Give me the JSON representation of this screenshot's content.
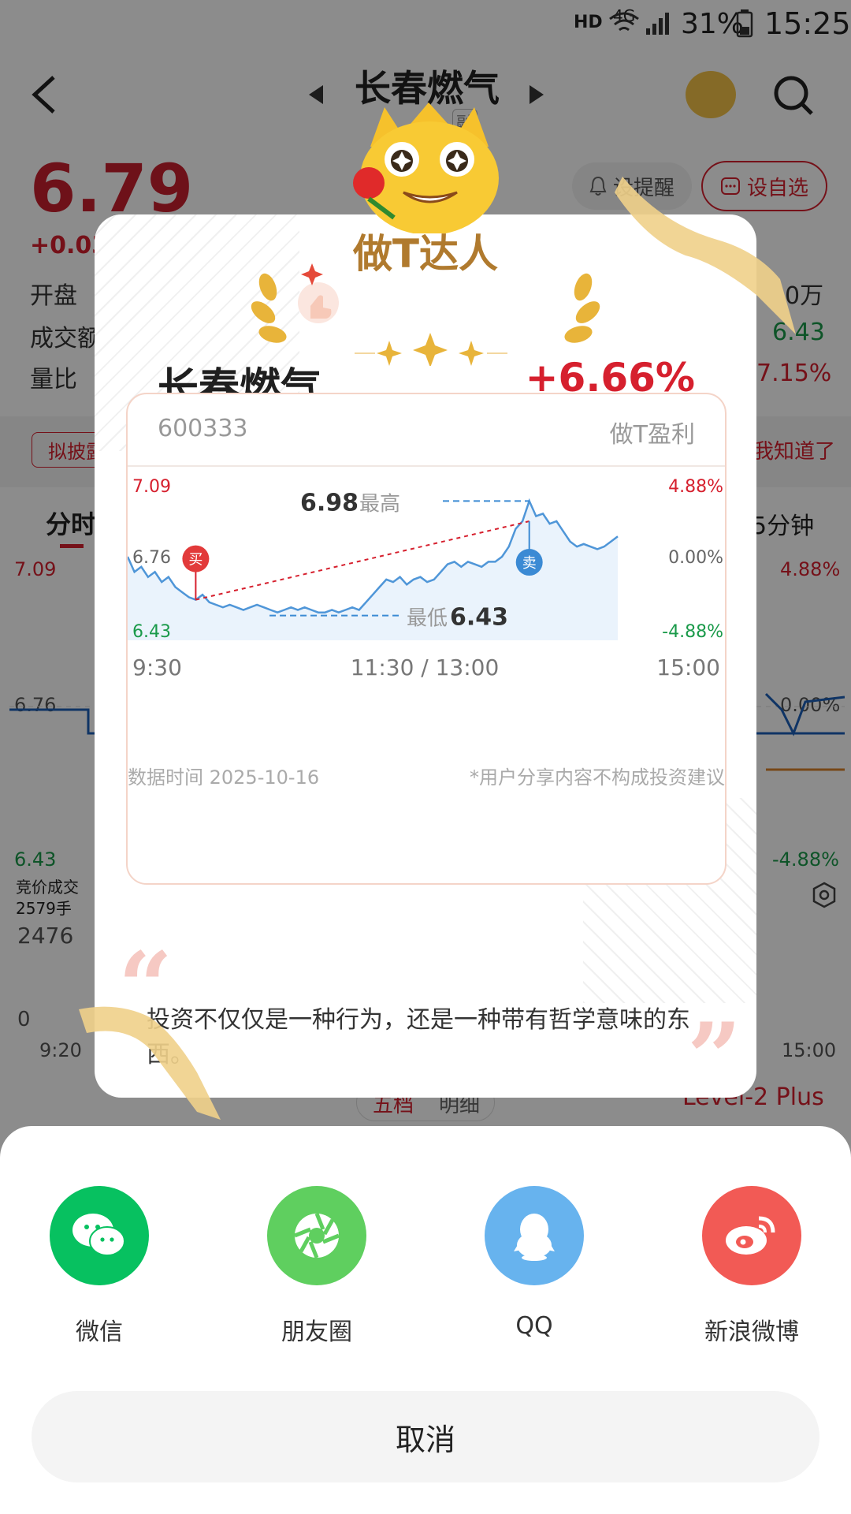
{
  "status_bar": {
    "hd": "HD",
    "network": "4G",
    "battery": "31%",
    "time": "15:25"
  },
  "header": {
    "title": "长春燃气",
    "subtitle": "融"
  },
  "background": {
    "price": "6.79",
    "change": "+0.03",
    "alert_button": "设提醒",
    "watchlist_button": "设自选",
    "labels": {
      "open": "开盘",
      "turnover": "成交额",
      "volume_ratio": "量比"
    },
    "right_values": {
      "volume": "0万",
      "high": "6.43",
      "ratio": "7.15%"
    },
    "notice_left": "拟披露",
    "notice_right": "我知道了",
    "tab_timeshare": "分时",
    "tab_5min": "5分钟",
    "left_axis": {
      "top": "7.09",
      "mid": "6.76",
      "bottom": "6.43"
    },
    "right_axis": {
      "top": "4.88%",
      "mid": "0.00%",
      "bottom": "-4.88%"
    },
    "auction_label": "竞价成交",
    "auction_volume": "2579手",
    "volume_value": "2476",
    "volume_zero": "0",
    "time_start": "9:20",
    "time_end": "15:00",
    "tab_five_levels": "五档",
    "tab_detail": "明细",
    "level2": "Level-2 Plus"
  },
  "card": {
    "badge_title": "做T达人",
    "stock_name": "长春燃气",
    "stock_change": "+6.66%",
    "code": "600333",
    "profit_label": "做T盈利",
    "high_value": "6.98",
    "high_label": "最高",
    "low_label": "最低",
    "low_value": "6.43",
    "buy_marker": "买",
    "sell_marker": "卖",
    "data_time": "数据时间 2025-10-16",
    "disclaimer": "*用户分享内容不构成投资建议",
    "quote": "投资不仅仅是一种行为，还是一种带有哲学意味的东西。"
  },
  "chart_data": {
    "type": "line",
    "title": "",
    "xlabel": "",
    "ylabel": "",
    "x_ticks": [
      "9:30",
      "11:30 / 13:00",
      "15:00"
    ],
    "y_ticks_left": [
      "7.09",
      "6.76",
      "6.43"
    ],
    "y_ticks_right": [
      "4.88%",
      "0.00%",
      "-4.88%"
    ],
    "ylim": [
      6.43,
      7.09
    ],
    "prev_close": 6.76,
    "series": [
      {
        "values": [
          6.76,
          6.7,
          6.72,
          6.68,
          6.7,
          6.66,
          6.68,
          6.64,
          6.62,
          6.6,
          6.59,
          6.61,
          6.58,
          6.57,
          6.56,
          6.57,
          6.56,
          6.55,
          6.56,
          6.57,
          6.56,
          6.55,
          6.54,
          6.55,
          6.56,
          6.55,
          6.56,
          6.55,
          6.54,
          6.54,
          6.55,
          6.54,
          6.55,
          6.56,
          6.55,
          6.58,
          6.61,
          6.64,
          6.67,
          6.66,
          6.68,
          6.65,
          6.67,
          6.68,
          6.66,
          6.67,
          6.7,
          6.73,
          6.74,
          6.72,
          6.74,
          6.73,
          6.72,
          6.74,
          6.74,
          6.76,
          6.8,
          6.87,
          6.9,
          6.98,
          6.92,
          6.93,
          6.89,
          6.9,
          6.86,
          6.82,
          6.8,
          6.81,
          6.8,
          6.79,
          6.8,
          6.82,
          6.84
        ]
      }
    ],
    "annotations": [
      {
        "label": "买",
        "index": 10,
        "price": 6.59
      },
      {
        "label": "卖",
        "index": 59,
        "price": 6.9
      },
      {
        "label": "最高",
        "price": 6.98
      },
      {
        "label": "最低",
        "price": 6.43
      }
    ]
  },
  "share": {
    "items": [
      {
        "label": "微信",
        "color": "#07c160",
        "icon": "wechat-icon"
      },
      {
        "label": "朋友圈",
        "color": "#5fcf5f",
        "icon": "moments-icon"
      },
      {
        "label": "QQ",
        "color": "#67b3ee",
        "icon": "qq-icon"
      },
      {
        "label": "新浪微博",
        "color": "#f25a55",
        "icon": "weibo-icon"
      }
    ],
    "cancel": "取消"
  }
}
